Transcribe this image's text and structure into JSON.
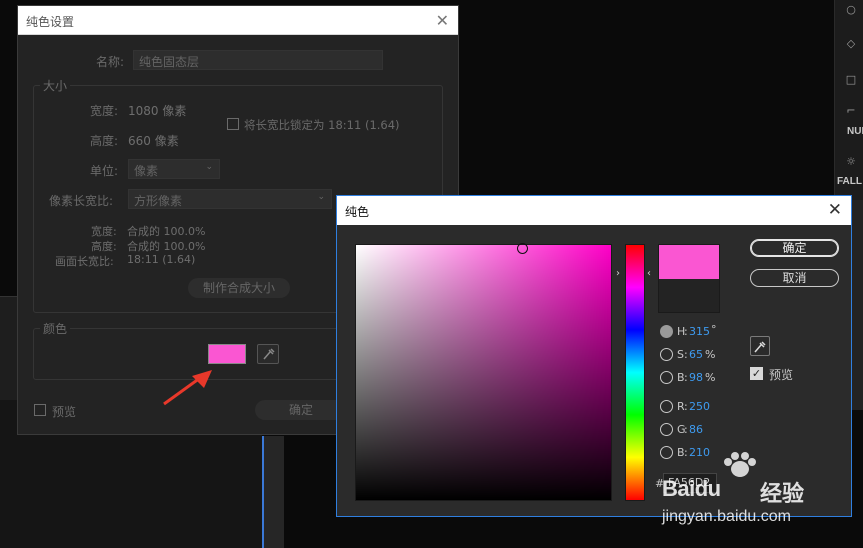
{
  "background": {
    "right_panel": {
      "labels": [
        "NUL",
        "FALL"
      ]
    }
  },
  "solid_settings": {
    "title": "纯色设置",
    "name_label": "名称:",
    "name_value": "纯色固态层",
    "size_group": "大小",
    "width_label": "宽度:",
    "width_value": "1080 像素",
    "height_label": "高度:",
    "height_value": "660 像素",
    "lock_ratio_label": "将长宽比锁定为 18:11 (1.64)",
    "units_label": "单位:",
    "units_value": "像素",
    "pixel_aspect_label": "像素长宽比:",
    "pixel_aspect_value": "方形像素",
    "info_width_label": "宽度:",
    "info_width_value": "合成的 100.0%",
    "info_height_label": "高度:",
    "info_height_value": "合成的 100.0%",
    "info_frame_label": "画面长宽比:",
    "info_frame_value": "18:11 (1.64)",
    "make_comp_size": "制作合成大小",
    "color_group": "颜色",
    "preview_label": "预览",
    "ok_label": "确定"
  },
  "color_picker": {
    "title": "纯色",
    "ok_label": "确定",
    "cancel_label": "取消",
    "preview_label": "预览",
    "preview_checked": true,
    "color_hex": "#FA56D2",
    "hsb": [
      {
        "key": "H",
        "value": "315",
        "unit": "°",
        "selected": true
      },
      {
        "key": "S",
        "value": "65",
        "unit": "%",
        "selected": false
      },
      {
        "key": "B",
        "value": "98",
        "unit": "%",
        "selected": false
      }
    ],
    "rgb": [
      {
        "key": "R",
        "value": "250"
      },
      {
        "key": "G",
        "value": "86"
      },
      {
        "key": "B",
        "value": "210"
      }
    ],
    "hex_prefix": "#",
    "hex_value": "FA56D2"
  },
  "watermark": {
    "brand": "Baidu",
    "brand_cn": "经验",
    "url": "jingyan.baidu.com"
  }
}
